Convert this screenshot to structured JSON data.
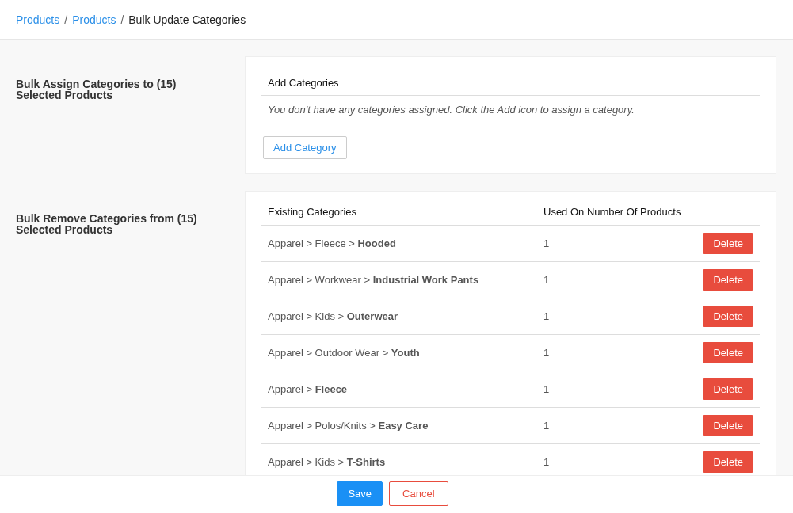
{
  "breadcrumb": [
    {
      "kind": "link",
      "label": "Products"
    },
    {
      "kind": "separator",
      "label": "/"
    },
    {
      "kind": "link",
      "label": "Products"
    },
    {
      "kind": "separator",
      "label": "/"
    },
    {
      "kind": "current",
      "label": "Bulk Update Categories"
    }
  ],
  "assign_section": {
    "title": "Bulk Assign Categories to (15) Selected Products",
    "card_title": "Add Categories",
    "empty_message": "You don't have any categories assigned. Click the Add icon to assign a category.",
    "add_button": "Add Category"
  },
  "remove_section": {
    "title": "Bulk Remove Categories from (15) Selected Products",
    "columns": [
      "Existing Categories",
      "Used On Number Of Products"
    ],
    "rows": [
      {
        "path": "Apparel > Fleece > **Hooded**",
        "count": "1",
        "action": "Delete"
      },
      {
        "path": "Apparel > Workwear > **Industrial Work Pants**",
        "count": "1",
        "action": "Delete"
      },
      {
        "path": "Apparel > Kids > **Outerwear**",
        "count": "1",
        "action": "Delete"
      },
      {
        "path": "Apparel > Outdoor Wear > **Youth**",
        "count": "1",
        "action": "Delete"
      },
      {
        "path": "Apparel > **Fleece**",
        "count": "1",
        "action": "Delete"
      },
      {
        "path": "Apparel > Polos/Knits > **Easy Care**",
        "count": "1",
        "action": "Delete"
      },
      {
        "path": "Apparel > Kids > **T-Shirts**",
        "count": "1",
        "action": "Delete"
      }
    ]
  },
  "footer": {
    "save": "Save",
    "cancel": "Cancel"
  }
}
